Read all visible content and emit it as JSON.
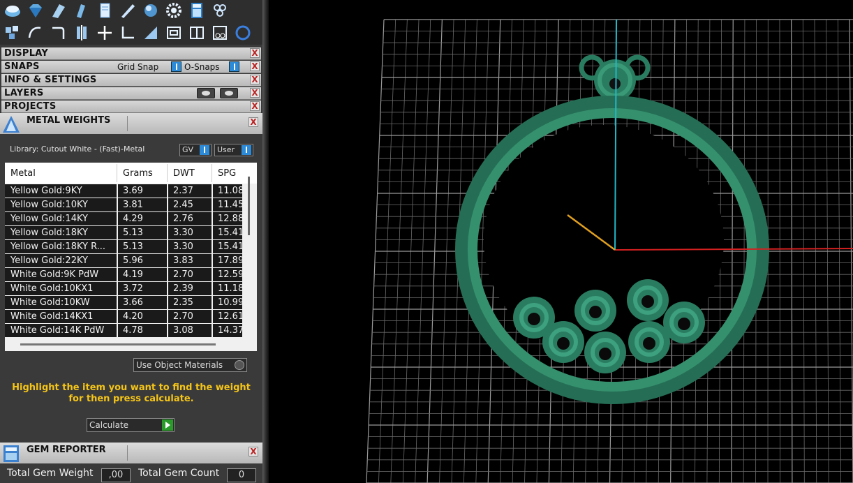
{
  "sections": {
    "display": "DISPLAY",
    "snaps": "SNAPS",
    "grid_snap": "Grid Snap",
    "o_snaps": "O-Snaps",
    "info": "INFO & SETTINGS",
    "layers": "LAYERS",
    "projects": "PROJECTS",
    "close_glyph": "X"
  },
  "metal_weights": {
    "title": "METAL WEIGHTS",
    "library": "Library: Cutout White - (Fast)-Metal",
    "gv_label": "GV",
    "user_label": "User",
    "columns": [
      "Metal",
      "Grams",
      "DWT",
      "SPG"
    ],
    "rows": [
      [
        "Yellow Gold:9KY",
        "3.69",
        "2.37",
        "11.08"
      ],
      [
        "Yellow Gold:10KY",
        "3.81",
        "2.45",
        "11.45"
      ],
      [
        "Yellow Gold:14KY",
        "4.29",
        "2.76",
        "12.88"
      ],
      [
        "Yellow Gold:18KY",
        "5.13",
        "3.30",
        "15.41"
      ],
      [
        "Yellow Gold:18KY R...",
        "5.13",
        "3.30",
        "15.41"
      ],
      [
        "Yellow Gold:22KY",
        "5.96",
        "3.83",
        "17.89"
      ],
      [
        "White Gold:9K PdW",
        "4.19",
        "2.70",
        "12.59"
      ],
      [
        "White Gold:10KX1",
        "3.72",
        "2.39",
        "11.18"
      ],
      [
        "White Gold:10KW",
        "3.66",
        "2.35",
        "10.99"
      ],
      [
        "White Gold:14KX1",
        "4.20",
        "2.70",
        "12.61"
      ],
      [
        "White Gold:14K PdW",
        "4.78",
        "3.08",
        "14.37"
      ]
    ],
    "use_object_materials": "Use Object Materials",
    "hint": "Highlight the item you want to find the weight for then press calculate.",
    "calculate": "Calculate"
  },
  "gem_reporter": {
    "title": "GEM REPORTER",
    "total_weight_label": "Total Gem Weight",
    "total_weight_value": ",00",
    "total_count_label": "Total Gem Count",
    "total_count_value": "0"
  },
  "colors": {
    "model": "#2e8a6a",
    "axis_x": "#d42020",
    "axis_y": "#1fb8c8",
    "axis_z": "#e0a020",
    "hint": "#f5c518"
  }
}
